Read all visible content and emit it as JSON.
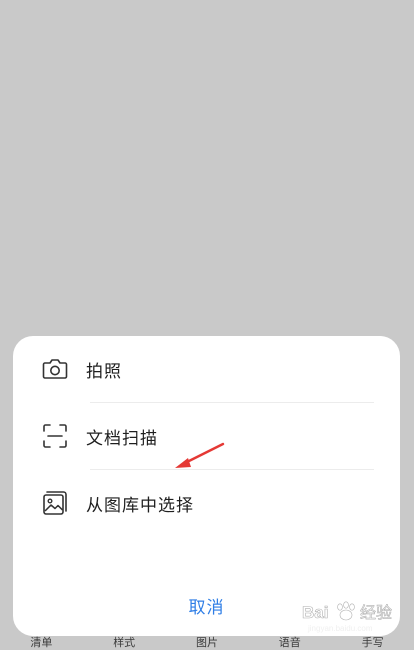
{
  "sheet": {
    "items": [
      {
        "label": "拍照",
        "icon": "camera-icon"
      },
      {
        "label": "文档扫描",
        "icon": "scan-icon"
      },
      {
        "label": "从图库中选择",
        "icon": "gallery-icon"
      }
    ],
    "cancel_label": "取消"
  },
  "toolbar": {
    "items": [
      "清单",
      "样式",
      "图片",
      "语音",
      "手写"
    ]
  },
  "watermark": {
    "text": "Bai 经验",
    "url": "jingyan.baidu.com"
  },
  "colors": {
    "backdrop": "#c9c9c9",
    "accent": "#2f7ee6",
    "annotation_arrow": "#e53935"
  }
}
